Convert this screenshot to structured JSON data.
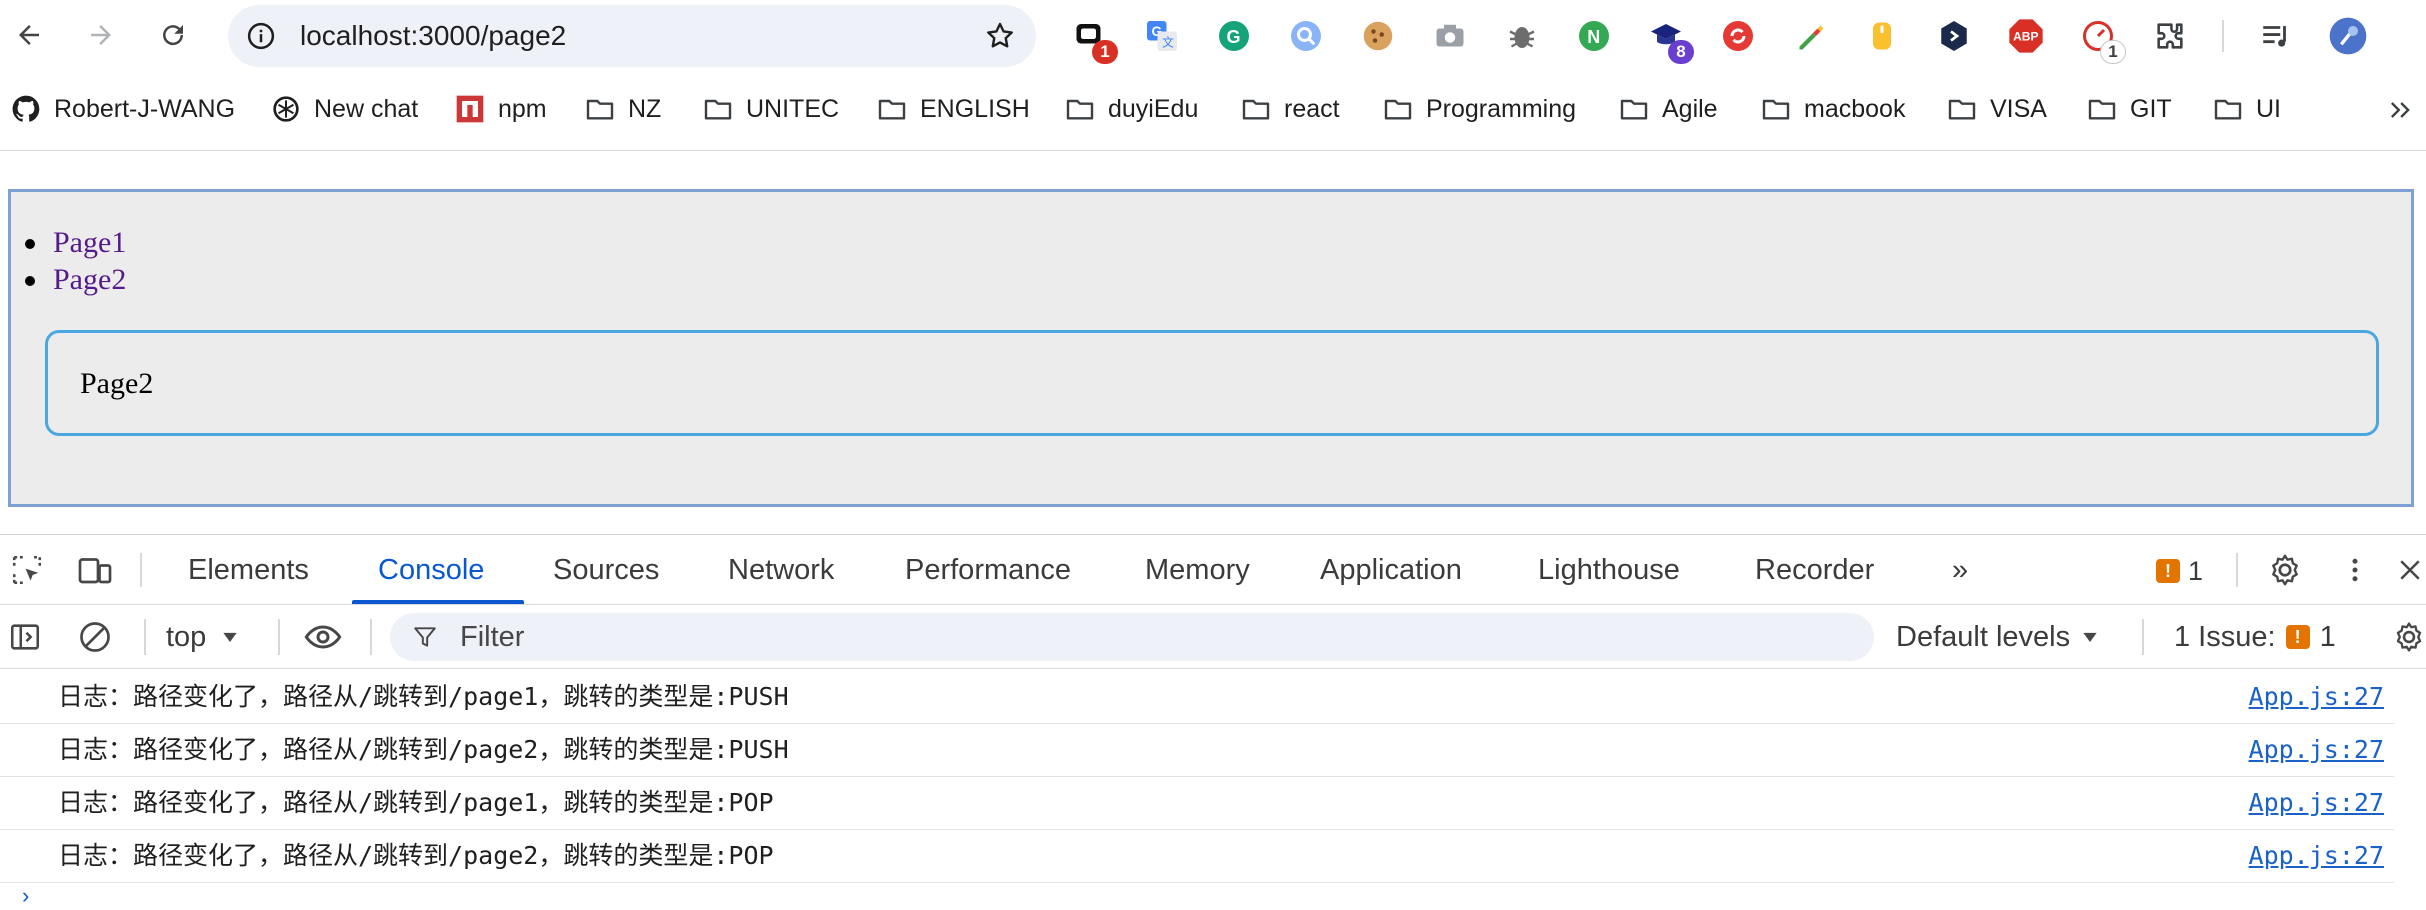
{
  "browser": {
    "url": "localhost:3000/page2",
    "extensions": [
      {
        "name": "ext-chat",
        "badge": "1",
        "badge_color": "#d93025"
      },
      {
        "name": "ext-google-translate"
      },
      {
        "name": "ext-grammarly"
      },
      {
        "name": "ext-search-lens"
      },
      {
        "name": "ext-cookie"
      },
      {
        "name": "ext-camera"
      },
      {
        "name": "ext-bug"
      },
      {
        "name": "ext-node"
      },
      {
        "name": "ext-graduation",
        "badge": "8",
        "badge_color": "#6a3fd0"
      },
      {
        "name": "ext-refresh"
      },
      {
        "name": "ext-color-picker"
      },
      {
        "name": "ext-mouse"
      },
      {
        "name": "ext-hex"
      },
      {
        "name": "ext-adblock",
        "label": "ABP"
      },
      {
        "name": "ext-speed",
        "badge": "1",
        "badge_color": "#5f6368"
      },
      {
        "name": "extensions-puzzle"
      }
    ]
  },
  "bookmarks": [
    {
      "label": "Robert-J-WANG",
      "icon": "github-icon"
    },
    {
      "label": "New chat",
      "icon": "openai-icon"
    },
    {
      "label": "npm",
      "icon": "npm-icon"
    },
    {
      "label": "NZ",
      "icon": "folder-icon"
    },
    {
      "label": "UNITEC",
      "icon": "folder-icon"
    },
    {
      "label": "ENGLISH",
      "icon": "folder-icon"
    },
    {
      "label": "duyiEdu",
      "icon": "folder-icon"
    },
    {
      "label": "react",
      "icon": "folder-icon"
    },
    {
      "label": "Programming",
      "icon": "folder-icon"
    },
    {
      "label": "Agile",
      "icon": "folder-icon"
    },
    {
      "label": "macbook",
      "icon": "folder-icon"
    },
    {
      "label": "VISA",
      "icon": "folder-icon"
    },
    {
      "label": "GIT",
      "icon": "folder-icon"
    },
    {
      "label": "UI",
      "icon": "folder-icon"
    }
  ],
  "page": {
    "nav": [
      "Page1",
      "Page2"
    ],
    "route_content": "Page2"
  },
  "devtools": {
    "tabs": [
      "Elements",
      "Console",
      "Sources",
      "Network",
      "Performance",
      "Memory",
      "Application",
      "Lighthouse",
      "Recorder"
    ],
    "active_tab": "Console",
    "more_tabs": "»",
    "issue_count": "1",
    "context": "top",
    "filter_placeholder": "Filter",
    "levels": "Default levels",
    "issues_label": "1 Issue:",
    "issues_badge_count": "1",
    "logs": [
      {
        "message": "日志：路径变化了，路径从/跳转到/page1，跳转的类型是:PUSH",
        "source": "App.js:27"
      },
      {
        "message": "日志：路径变化了，路径从/跳转到/page2，跳转的类型是:PUSH",
        "source": "App.js:27"
      },
      {
        "message": "日志：路径变化了，路径从/跳转到/page1，跳转的类型是:POP",
        "source": "App.js:27"
      },
      {
        "message": "日志：路径变化了，路径从/跳转到/page2，跳转的类型是:POP",
        "source": "App.js:27"
      }
    ]
  },
  "colors": {
    "accent": "#0b57d0",
    "link_visited": "#551a8b",
    "app_border": "#7ea2d4",
    "route_border": "#4aa7e0",
    "issue_orange": "#e37400"
  }
}
